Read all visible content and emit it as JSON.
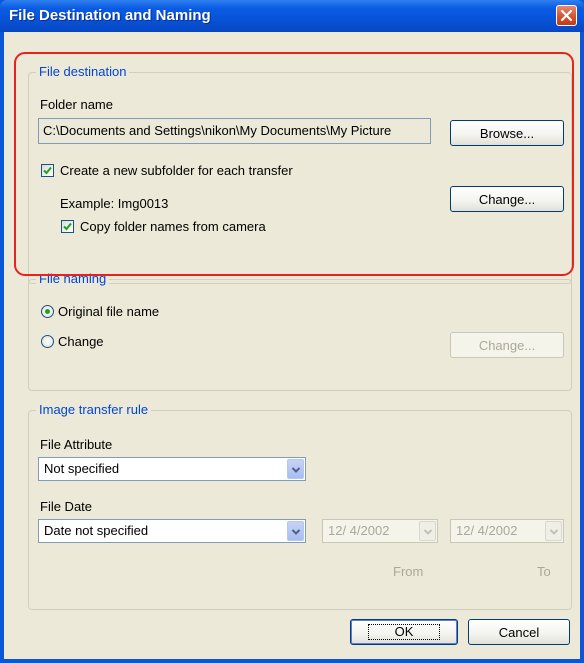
{
  "window": {
    "title": "File Destination and Naming",
    "close_icon": "close-icon"
  },
  "destination": {
    "group_title": "File destination",
    "folder_label": "Folder name",
    "folder_value": "C:\\Documents and Settings\\nikon\\My Documents\\My Picture",
    "browse_label": "Browse...",
    "subfolder_checkbox": {
      "label": "Create a new subfolder for each transfer",
      "checked": true
    },
    "example_text": "Example: Img0013",
    "change_label": "Change...",
    "copy_checkbox": {
      "label": "Copy folder names from camera",
      "checked": true
    }
  },
  "naming": {
    "group_title": "File naming",
    "original_radio": {
      "label": "Original file name",
      "selected": true
    },
    "change_radio": {
      "label": "Change",
      "selected": false
    },
    "change_label": "Change..."
  },
  "transfer_rule": {
    "group_title": "Image transfer rule",
    "attribute_label": "File Attribute",
    "attribute_value": "Not specified",
    "date_label": "File Date",
    "date_value": "Date not specified",
    "from_date": "12/ 4/2002",
    "to_date": "12/ 4/2002",
    "from_label": "From",
    "to_label": "To"
  },
  "footer": {
    "ok_label": "OK",
    "cancel_label": "Cancel"
  },
  "colors": {
    "highlight": "#e8231f",
    "group_title": "#0046d5",
    "titlebar": "#0853d8"
  }
}
